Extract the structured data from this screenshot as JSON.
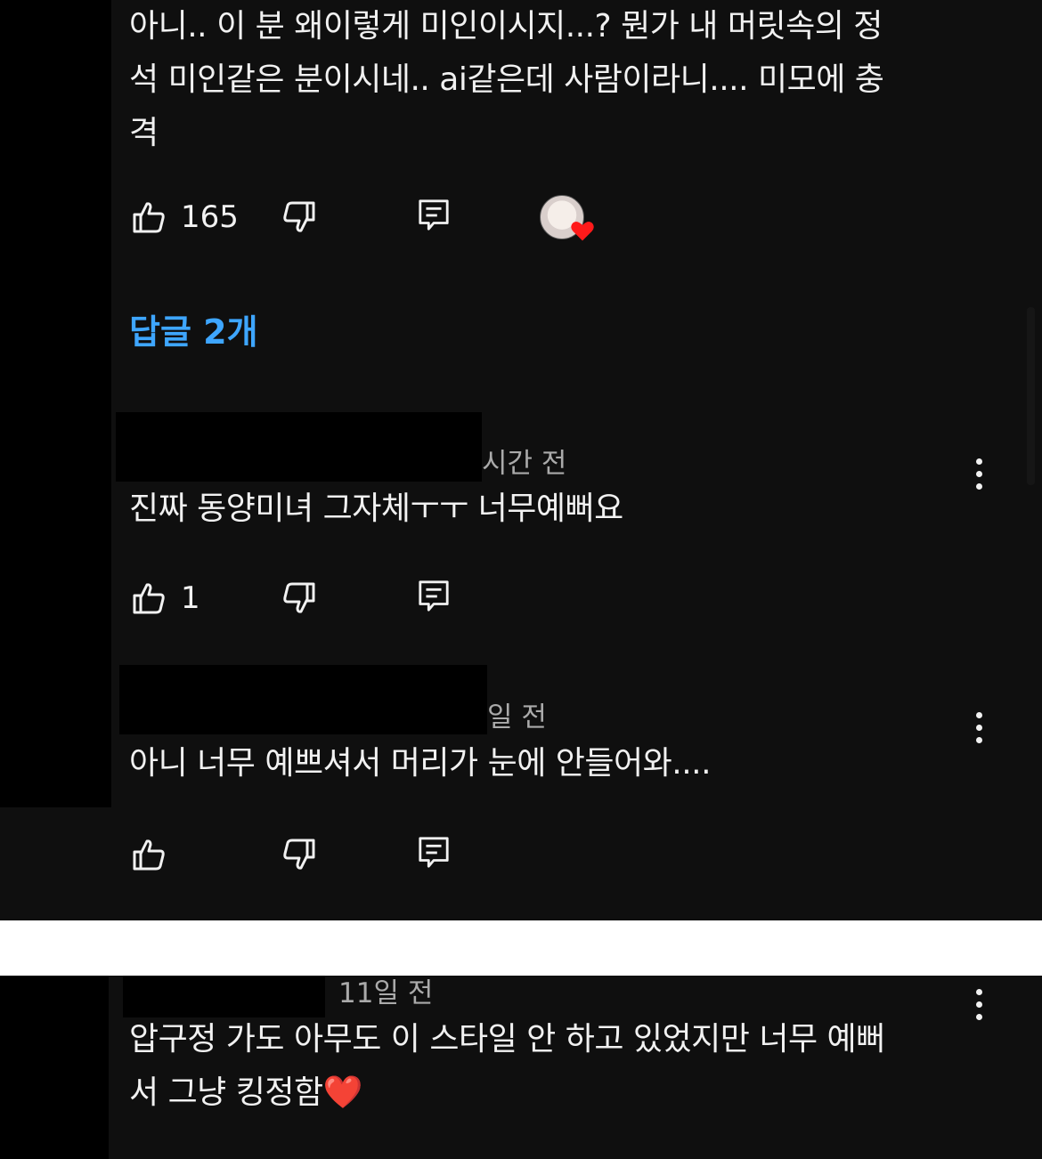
{
  "main_comment": {
    "lines": [
      "아니.. 이 분 왜이렇게 미인이시지...? 뭔가 내 머릿속의 정",
      "석 미인같은 분이시네.. ai같은데 사람이라니.... 미모에 충",
      "격"
    ],
    "likes": "165",
    "replies_label": "답글 2개"
  },
  "replies": [
    {
      "meta": "시간 전",
      "text": "진짜 동양미녀 그자체ㅜㅜ 너무예뻐요",
      "likes": "1"
    },
    {
      "meta": "일 전",
      "text": "아니 너무 예쁘셔서 머리가 눈에 안들어와....",
      "likes": ""
    }
  ],
  "second_comment": {
    "meta": "11일 전",
    "lines": [
      "압구정 가도 아무도 이 스타일 안 하고 있었지만 너무 예뻐",
      "서 그냥 킹정함"
    ],
    "emoji": "❤️"
  },
  "icons": [
    "like-icon",
    "dislike-icon",
    "reply-icon",
    "more-options-icon",
    "heart-icon"
  ],
  "colors": {
    "background": "#0f0f0f",
    "text": "#f1f1f1",
    "secondary": "#aaaaaa",
    "link": "#3ea6ff",
    "heart": "#ff1a1a"
  }
}
